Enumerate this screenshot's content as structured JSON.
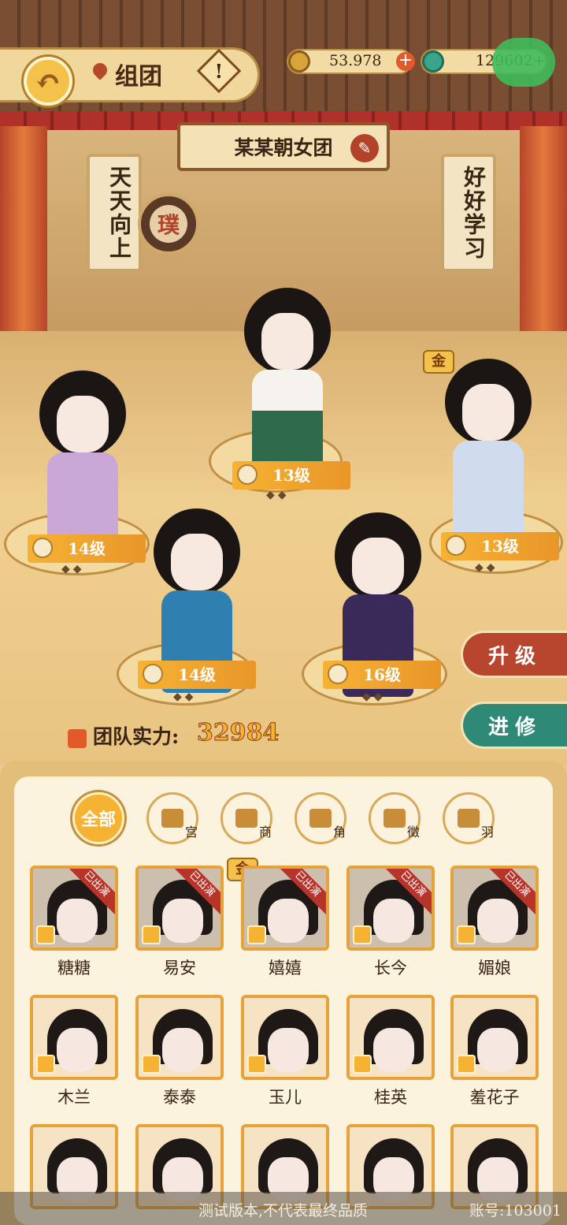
{
  "header": {
    "title": "组团",
    "info_symbol": "!",
    "back_symbol": "↶"
  },
  "resources": {
    "coins": "53.978",
    "jade": "129602+",
    "plus": "+"
  },
  "team": {
    "name": "某某朝女团",
    "edit_symbol": "✎",
    "badge": "璞",
    "gold_tag": "金"
  },
  "banners": {
    "left": "天天向上",
    "right": "好好学习"
  },
  "members": [
    {
      "level": "14级"
    },
    {
      "level": "13级"
    },
    {
      "level": "13级"
    },
    {
      "level": "14级"
    },
    {
      "level": "16级"
    }
  ],
  "actions": {
    "upgrade": "升级",
    "advance": "进修"
  },
  "power": {
    "label": "团队实力:",
    "value": "32984"
  },
  "filters": [
    {
      "label": "全部"
    },
    {
      "label": "宫"
    },
    {
      "label": "商"
    },
    {
      "label": "角"
    },
    {
      "label": "徵"
    },
    {
      "label": "羽"
    }
  ],
  "roster": [
    {
      "name": "糖糖",
      "status": "已出演"
    },
    {
      "name": "易安",
      "status": "已出演"
    },
    {
      "name": "嬉嬉",
      "status": "已出演"
    },
    {
      "name": "长今",
      "status": "已出演"
    },
    {
      "name": "媚娘",
      "status": "已出演"
    },
    {
      "name": "木兰"
    },
    {
      "name": "泰泰"
    },
    {
      "name": "玉儿"
    },
    {
      "name": "桂英"
    },
    {
      "name": "羞花子"
    }
  ],
  "watermark": {
    "notice": "测试版本,不代表最终品质",
    "account": "账号:103001"
  },
  "colors": {
    "accent": "#f6b233",
    "upgrade": "#b8452e",
    "advance": "#2e8a76",
    "ribbon": "#b8342a"
  }
}
